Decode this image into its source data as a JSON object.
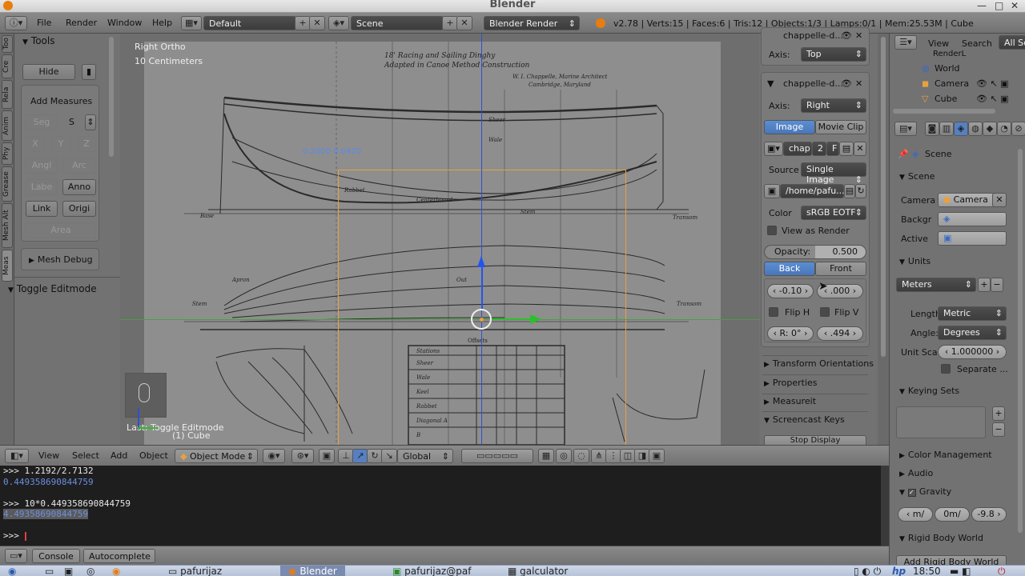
{
  "window": {
    "title": "Blender"
  },
  "menubar": {
    "items": [
      "File",
      "Render",
      "Window",
      "Help"
    ],
    "layout": "Default",
    "scene": "Scene",
    "engine": "Blender Render",
    "stats": "v2.78 | Verts:15 | Faces:6 | Tris:12 | Objects:1/3 | Lamps:0/1 | Mem:25.53M | Cube"
  },
  "tool_tabs": [
    "Meas",
    "Mesh Alt",
    "Grease",
    "Phy",
    "Anim",
    "Rela",
    "Cre",
    "Too"
  ],
  "toolshelf": {
    "title": "Tools",
    "hide": "Hide",
    "add_measures": "Add Measures",
    "seg": "Seg",
    "seg_value": "S",
    "x": "X",
    "y": "Y",
    "z": "Z",
    "angl": "Angl",
    "arc": "Arc",
    "labe": "Labe",
    "anno": "Anno",
    "link": "Link",
    "origi": "Origi",
    "area": "Area",
    "mesh_debug": "Mesh Debug",
    "toggle_editmode": "Toggle Editmode"
  },
  "viewport": {
    "view": "Right Ortho",
    "scale": "10 Centimeters",
    "measure_label": "0.2000 0.0420",
    "last_op": "Last: Toggle Editmode",
    "object": "(1) Cube",
    "offsets_label": "Offsets",
    "blueprint": {
      "title_line1": "18' Racing and Sailing Dinghy",
      "title_line2": "Adapted in Canoe Method Construction",
      "author_line1": "W. I. Chappelle, Marine Architect",
      "author_line2": "Cambridge, Maryland",
      "labels": {
        "sheer": "Sheer",
        "wale": "Wale",
        "rabbet": "Rabbet",
        "centerboard": "Centerboard",
        "base": "Base",
        "stem": "Stem",
        "transom": "Transom",
        "out": "Out",
        "apron": "Apron",
        "stations": "Stations",
        "row_sheer": "Sheer",
        "row_wale": "Wale",
        "row_keel": "Keel",
        "row_rabbet": "Rabbet",
        "row_diag": "Diagonal A",
        "row_diag_b": "B"
      }
    }
  },
  "npanel": {
    "img1_name": "chappelle-d...",
    "axis_label": "Axis:",
    "axis1": "Top",
    "img2_name": "chappelle-d...",
    "axis2": "Right",
    "image_tab": "Image",
    "movie_tab": "Movie Clip",
    "chap": "chap",
    "users": "2",
    "fake": "F",
    "source_label": "Source",
    "source": "Single Image",
    "filepath": "/home/pafu...",
    "color_label": "Color",
    "colorspace": "sRGB EOTF",
    "view_as_render": "View as Render",
    "opacity": "Opacity:",
    "opacity_value": "0.500",
    "back": "Back",
    "front": "Front",
    "offset_x": "-0.10",
    "offset_y": ".000",
    "flip_h": "Flip H",
    "flip_v": "Flip V",
    "rotation": "R: 0°",
    "size": ".494",
    "sections": [
      "Transform Orientations",
      "Properties",
      "Measureit",
      "Screencast Keys"
    ],
    "stop_display": "Stop Display"
  },
  "vp_header": {
    "view": "View",
    "select": "Select",
    "add": "Add",
    "object": "Object",
    "mode": "Object Mode",
    "orientation": "Global"
  },
  "console": {
    "lines": [
      {
        "text": ">>> 1.2192/2.7132",
        "color": "#e8e8e8"
      },
      {
        "text": "0.449358690844759",
        "color": "#6c8ee0"
      },
      {
        "text": "",
        "color": "#e8e8e8"
      },
      {
        "text": ">>> 10*0.449358690844759",
        "color": "#e8e8e8"
      },
      {
        "text": "4.49358690844759",
        "color": "#6c8ee0"
      },
      {
        "text": "",
        "color": "#e8e8e8"
      },
      {
        "text": ">>> ",
        "color": "#e8e8e8"
      }
    ],
    "console_btn": "Console",
    "autocomplete_btn": "Autocomplete"
  },
  "outliner": {
    "view": "View",
    "search": "Search",
    "all_scenes": "All Sc",
    "items": [
      "RenderL",
      "World",
      "Camera",
      "Cube"
    ]
  },
  "props": {
    "scene_path": "Scene",
    "scene_panel": "Scene",
    "camera_label": "Camera",
    "camera": "Camera",
    "backgr": "Backgr",
    "active": "Active",
    "units_panel": "Units",
    "unit_preset": "Meters",
    "length_label": "Length:",
    "length": "Metric",
    "angle_label": "Angle:",
    "angle": "Degrees",
    "unit_scale_label": "Unit Sca",
    "unit_scale": "1.000000",
    "separate": "Separate ...",
    "keying": "Keying Sets",
    "color_mgmt": "Color Management",
    "audio": "Audio",
    "gravity": "Gravity",
    "g_x": "m/",
    "g_y": "0m/",
    "g_z": "-9.8",
    "rigid": "Rigid Body World",
    "add_rigid": "Add Rigid Body World"
  },
  "taskbar": {
    "items": [
      "pafurijaz",
      "Blender",
      "pafurijaz@paf",
      "galculator"
    ],
    "clock": "18:50"
  },
  "colors": {
    "accent": "#5680c2",
    "orange": "#e8a040",
    "console_bg": "#1e1e1e"
  }
}
